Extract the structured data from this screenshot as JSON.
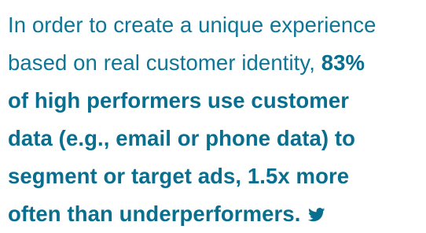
{
  "quote": {
    "lines": [
      {
        "normal": "In order to create a unique experience",
        "bold": ""
      },
      {
        "normal": "based on real customer identity, ",
        "bold": "83%"
      },
      {
        "normal": "",
        "bold": "of high performers use customer"
      },
      {
        "normal": "",
        "bold": "data (e.g., email or phone data) to"
      },
      {
        "normal": "",
        "bold": "segment or target ads, 1.5x more"
      },
      {
        "normal": "",
        "bold": "often than underperformers."
      }
    ]
  },
  "icons": {
    "tweet": "twitter-bird-icon"
  },
  "colors": {
    "text": "#0e7596",
    "icon": "#0a6e8e"
  }
}
